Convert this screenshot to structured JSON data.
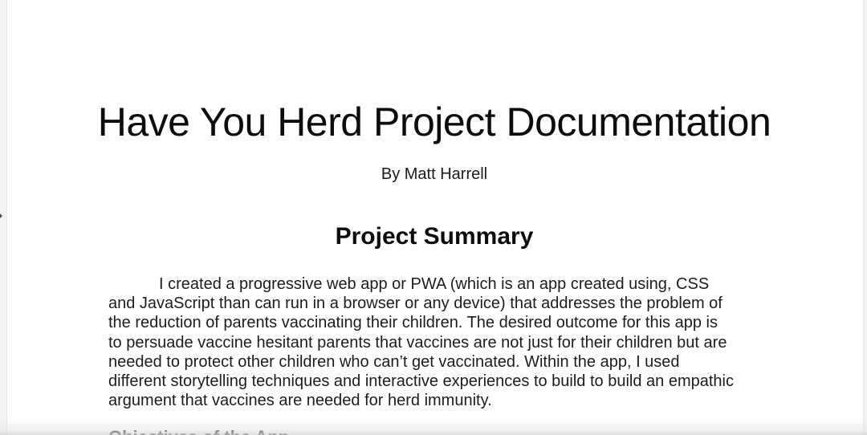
{
  "document": {
    "title": "Have You Herd Project Documentation",
    "author": "By Matt Harrell",
    "sections": [
      {
        "heading": "Project Summary",
        "lines": [
          "I created a progressive web app or PWA (which is an app created using, CSS",
          "and JavaScript than can run in a browser or any device) that addresses the problem of",
          "the reduction of parents vaccinating their children. The desired outcome for this app is",
          "to persuade vaccine hesitant parents that vaccines are not just for their children but are",
          "needed to protect other children who can’t get vaccinated. Within the app, I used",
          "different storytelling techniques and interactive experiences to build to build an empathic",
          "argument that vaccines are needed for herd immunity."
        ]
      },
      {
        "heading": "Objectives of the App"
      }
    ]
  }
}
